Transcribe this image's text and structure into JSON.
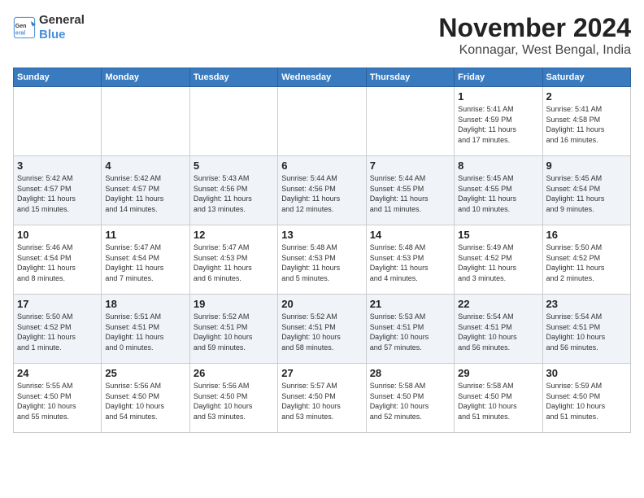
{
  "header": {
    "logo_general": "General",
    "logo_blue": "Blue",
    "title": "November 2024",
    "location": "Konnagar, West Bengal, India"
  },
  "weekdays": [
    "Sunday",
    "Monday",
    "Tuesday",
    "Wednesday",
    "Thursday",
    "Friday",
    "Saturday"
  ],
  "weeks": [
    [
      {
        "day": "",
        "info": ""
      },
      {
        "day": "",
        "info": ""
      },
      {
        "day": "",
        "info": ""
      },
      {
        "day": "",
        "info": ""
      },
      {
        "day": "",
        "info": ""
      },
      {
        "day": "1",
        "info": "Sunrise: 5:41 AM\nSunset: 4:59 PM\nDaylight: 11 hours\nand 17 minutes."
      },
      {
        "day": "2",
        "info": "Sunrise: 5:41 AM\nSunset: 4:58 PM\nDaylight: 11 hours\nand 16 minutes."
      }
    ],
    [
      {
        "day": "3",
        "info": "Sunrise: 5:42 AM\nSunset: 4:57 PM\nDaylight: 11 hours\nand 15 minutes."
      },
      {
        "day": "4",
        "info": "Sunrise: 5:42 AM\nSunset: 4:57 PM\nDaylight: 11 hours\nand 14 minutes."
      },
      {
        "day": "5",
        "info": "Sunrise: 5:43 AM\nSunset: 4:56 PM\nDaylight: 11 hours\nand 13 minutes."
      },
      {
        "day": "6",
        "info": "Sunrise: 5:44 AM\nSunset: 4:56 PM\nDaylight: 11 hours\nand 12 minutes."
      },
      {
        "day": "7",
        "info": "Sunrise: 5:44 AM\nSunset: 4:55 PM\nDaylight: 11 hours\nand 11 minutes."
      },
      {
        "day": "8",
        "info": "Sunrise: 5:45 AM\nSunset: 4:55 PM\nDaylight: 11 hours\nand 10 minutes."
      },
      {
        "day": "9",
        "info": "Sunrise: 5:45 AM\nSunset: 4:54 PM\nDaylight: 11 hours\nand 9 minutes."
      }
    ],
    [
      {
        "day": "10",
        "info": "Sunrise: 5:46 AM\nSunset: 4:54 PM\nDaylight: 11 hours\nand 8 minutes."
      },
      {
        "day": "11",
        "info": "Sunrise: 5:47 AM\nSunset: 4:54 PM\nDaylight: 11 hours\nand 7 minutes."
      },
      {
        "day": "12",
        "info": "Sunrise: 5:47 AM\nSunset: 4:53 PM\nDaylight: 11 hours\nand 6 minutes."
      },
      {
        "day": "13",
        "info": "Sunrise: 5:48 AM\nSunset: 4:53 PM\nDaylight: 11 hours\nand 5 minutes."
      },
      {
        "day": "14",
        "info": "Sunrise: 5:48 AM\nSunset: 4:53 PM\nDaylight: 11 hours\nand 4 minutes."
      },
      {
        "day": "15",
        "info": "Sunrise: 5:49 AM\nSunset: 4:52 PM\nDaylight: 11 hours\nand 3 minutes."
      },
      {
        "day": "16",
        "info": "Sunrise: 5:50 AM\nSunset: 4:52 PM\nDaylight: 11 hours\nand 2 minutes."
      }
    ],
    [
      {
        "day": "17",
        "info": "Sunrise: 5:50 AM\nSunset: 4:52 PM\nDaylight: 11 hours\nand 1 minute."
      },
      {
        "day": "18",
        "info": "Sunrise: 5:51 AM\nSunset: 4:51 PM\nDaylight: 11 hours\nand 0 minutes."
      },
      {
        "day": "19",
        "info": "Sunrise: 5:52 AM\nSunset: 4:51 PM\nDaylight: 10 hours\nand 59 minutes."
      },
      {
        "day": "20",
        "info": "Sunrise: 5:52 AM\nSunset: 4:51 PM\nDaylight: 10 hours\nand 58 minutes."
      },
      {
        "day": "21",
        "info": "Sunrise: 5:53 AM\nSunset: 4:51 PM\nDaylight: 10 hours\nand 57 minutes."
      },
      {
        "day": "22",
        "info": "Sunrise: 5:54 AM\nSunset: 4:51 PM\nDaylight: 10 hours\nand 56 minutes."
      },
      {
        "day": "23",
        "info": "Sunrise: 5:54 AM\nSunset: 4:51 PM\nDaylight: 10 hours\nand 56 minutes."
      }
    ],
    [
      {
        "day": "24",
        "info": "Sunrise: 5:55 AM\nSunset: 4:50 PM\nDaylight: 10 hours\nand 55 minutes."
      },
      {
        "day": "25",
        "info": "Sunrise: 5:56 AM\nSunset: 4:50 PM\nDaylight: 10 hours\nand 54 minutes."
      },
      {
        "day": "26",
        "info": "Sunrise: 5:56 AM\nSunset: 4:50 PM\nDaylight: 10 hours\nand 53 minutes."
      },
      {
        "day": "27",
        "info": "Sunrise: 5:57 AM\nSunset: 4:50 PM\nDaylight: 10 hours\nand 53 minutes."
      },
      {
        "day": "28",
        "info": "Sunrise: 5:58 AM\nSunset: 4:50 PM\nDaylight: 10 hours\nand 52 minutes."
      },
      {
        "day": "29",
        "info": "Sunrise: 5:58 AM\nSunset: 4:50 PM\nDaylight: 10 hours\nand 51 minutes."
      },
      {
        "day": "30",
        "info": "Sunrise: 5:59 AM\nSunset: 4:50 PM\nDaylight: 10 hours\nand 51 minutes."
      }
    ]
  ]
}
